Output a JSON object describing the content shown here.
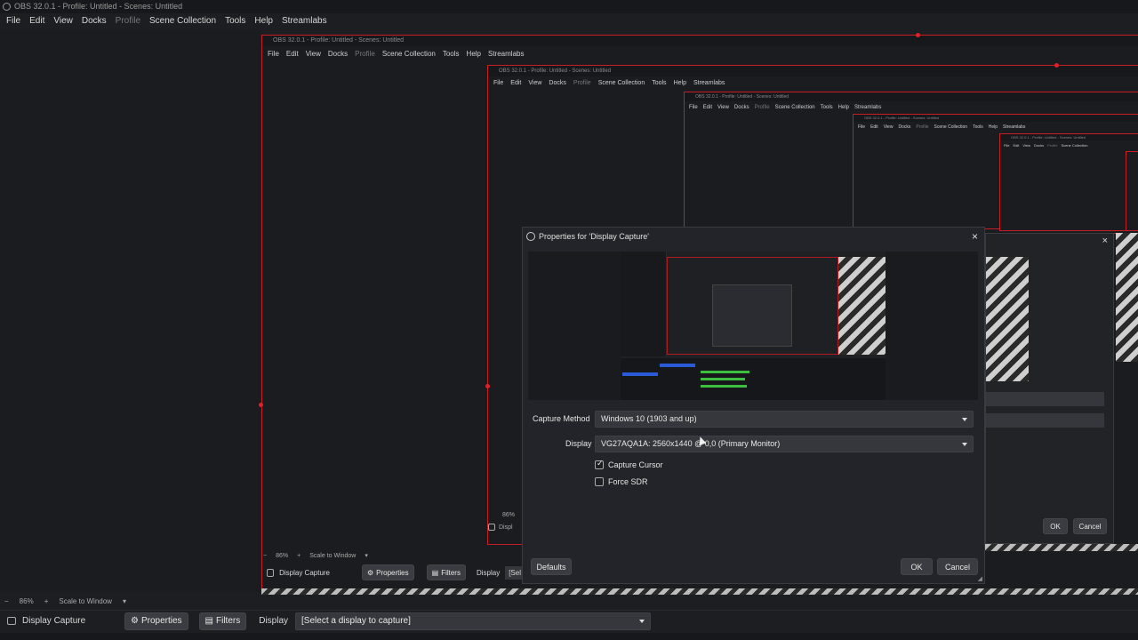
{
  "window": {
    "title": "OBS 32.0.1 - Profile: Untitled - Scenes: Untitled"
  },
  "menu": [
    "File",
    "Edit",
    "View",
    "Docks",
    "Profile",
    "Scene Collection",
    "Tools",
    "Help",
    "Streamlabs"
  ],
  "zoom": {
    "minus": "−",
    "percent": "86%",
    "plus": "+",
    "mode": "Scale to Window"
  },
  "toolbar": {
    "source_name": "Display Capture",
    "properties_label": "Properties",
    "filters_label": "Filters",
    "display_label": "Display",
    "display_select": "[Select a display to capture]"
  },
  "nested2_toolbar": {
    "source_name": "Display Capture",
    "properties_label": "Properties",
    "filters_label": "Filters",
    "display_label": "Display",
    "display_select": "[Sel"
  },
  "nested3": {
    "zoom_percent": "86%",
    "source_name": "Displ"
  },
  "dialog": {
    "title": "Properties for 'Display Capture'",
    "capture_method_label": "Capture Method",
    "capture_method_value": "Windows 10 (1903 and up)",
    "display_label": "Display",
    "display_value": "VG27AQA1A: 2560x1440 @ 0,0 (Primary Monitor)",
    "capture_cursor_label": "Capture Cursor",
    "capture_cursor_checked": true,
    "force_sdr_label": "Force SDR",
    "force_sdr_checked": false,
    "defaults_label": "Defaults",
    "ok_label": "OK",
    "cancel_label": "Cancel"
  },
  "bg_dialog": {
    "ok_label": "OK",
    "cancel_label": "Cancel"
  },
  "colors": {
    "accent_red": "#c81d25",
    "bg": "#1d1e22",
    "button": "#3b3c42"
  }
}
